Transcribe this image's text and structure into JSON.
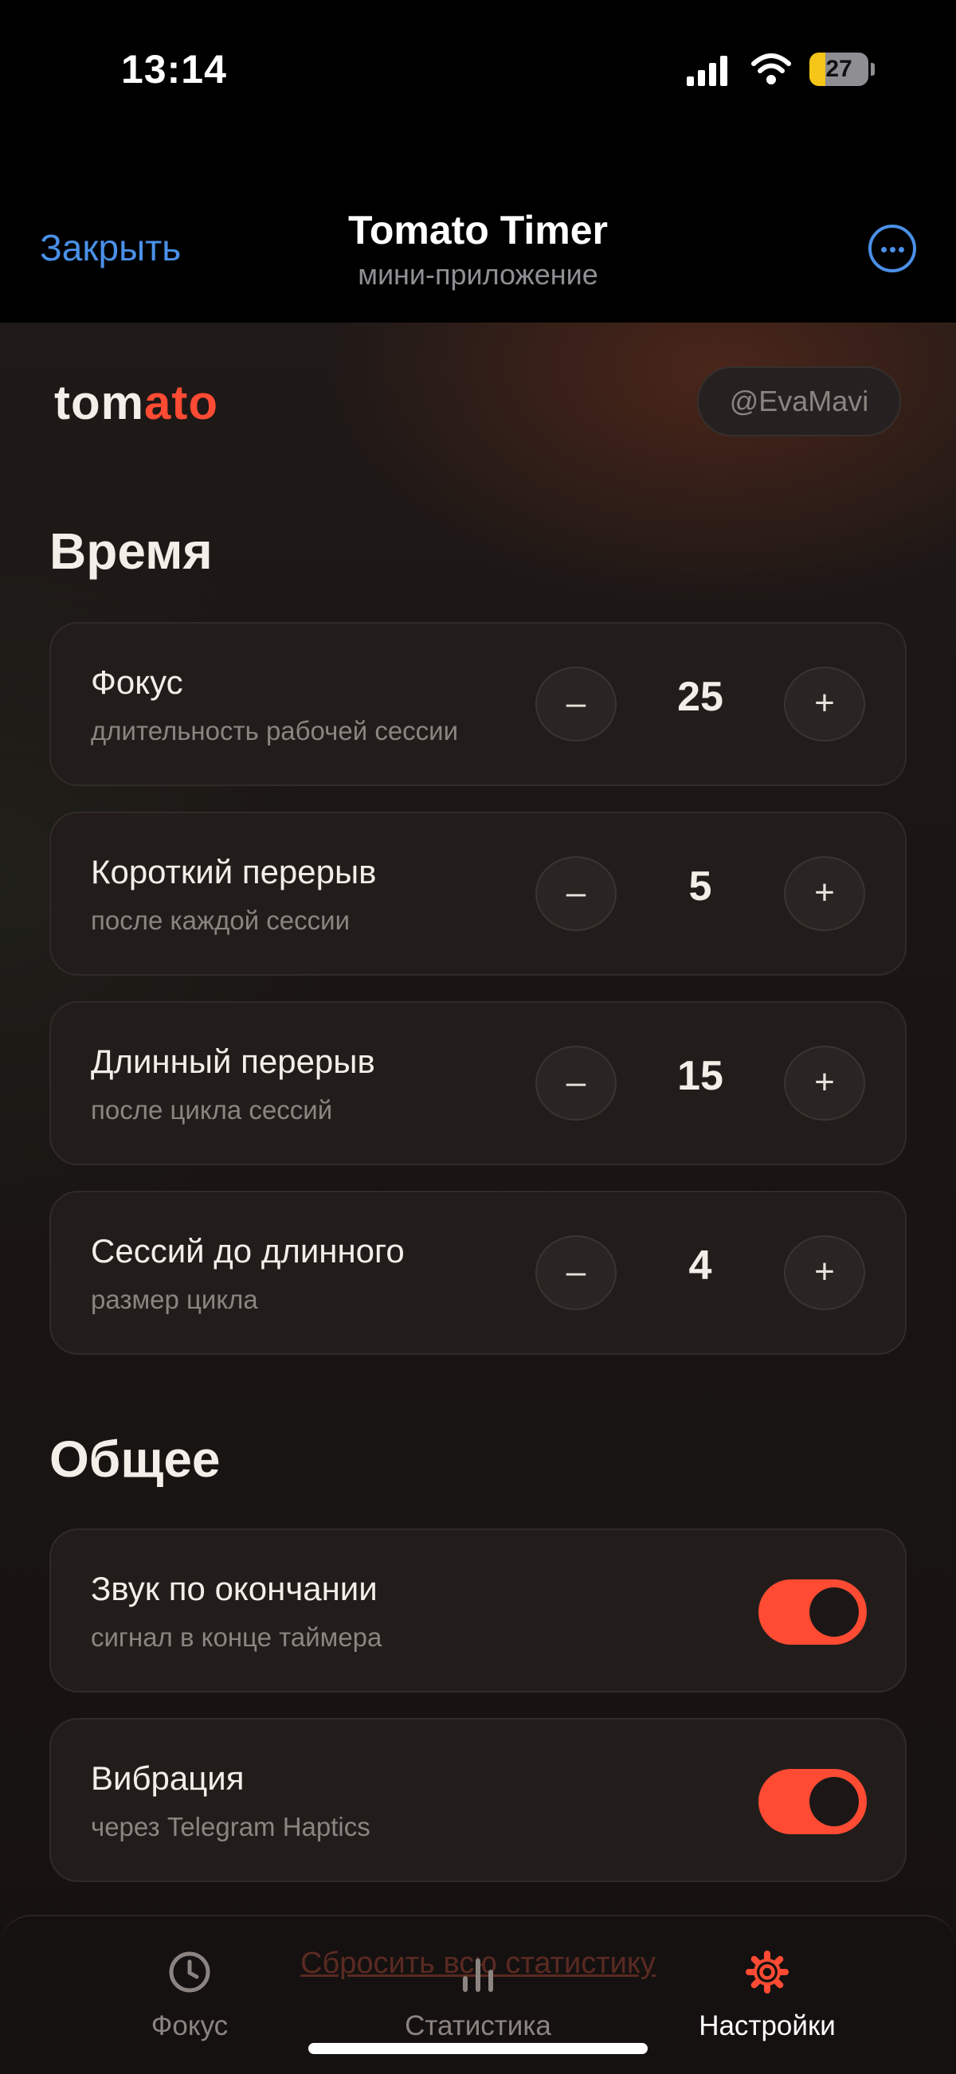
{
  "status_bar": {
    "time": "13:14",
    "battery": "27",
    "battery_level": 0.27
  },
  "header": {
    "close_label": "Закрыть",
    "title": "Tomato Timer",
    "subtitle": "мини-приложение",
    "more_icon": "ellipsis-circle-icon"
  },
  "brand": {
    "logo_part1": "tom",
    "logo_part2": "ato",
    "accent_color": "#ff4b33"
  },
  "user": {
    "handle": "@EvaMavi"
  },
  "time_section": {
    "title": "Время",
    "items": [
      {
        "label": "Фокус",
        "desc": "длительность рабочей сессии",
        "value": "25",
        "minus": "–",
        "plus": "+"
      },
      {
        "label": "Короткий перерыв",
        "desc": "после каждой сессии",
        "value": "5",
        "minus": "–",
        "plus": "+"
      },
      {
        "label": "Длинный перерыв",
        "desc": "после цикла сессий",
        "value": "15",
        "minus": "–",
        "plus": "+"
      },
      {
        "label": "Сессий до длинного",
        "desc": "размер цикла",
        "value": "4",
        "minus": "–",
        "plus": "+"
      }
    ]
  },
  "general_section": {
    "title": "Общее",
    "items": [
      {
        "label": "Звук по окончании",
        "desc": "сигнал в конце таймера",
        "enabled": true
      },
      {
        "label": "Вибрация",
        "desc": "через Telegram Haptics",
        "enabled": true
      }
    ]
  },
  "reset_label": "Сбросить всю статистику",
  "tabs": [
    {
      "label": "Фокус",
      "icon": "clock-icon",
      "active": false
    },
    {
      "label": "Статистика",
      "icon": "bar-chart-icon",
      "active": false
    },
    {
      "label": "Настройки",
      "icon": "gear-icon",
      "active": true
    }
  ],
  "colors": {
    "ios_blue": "#4a90e8",
    "tab_inactive": "#8c8480",
    "tab_active": "#ffffff",
    "icon_active": "#ff4b33"
  }
}
